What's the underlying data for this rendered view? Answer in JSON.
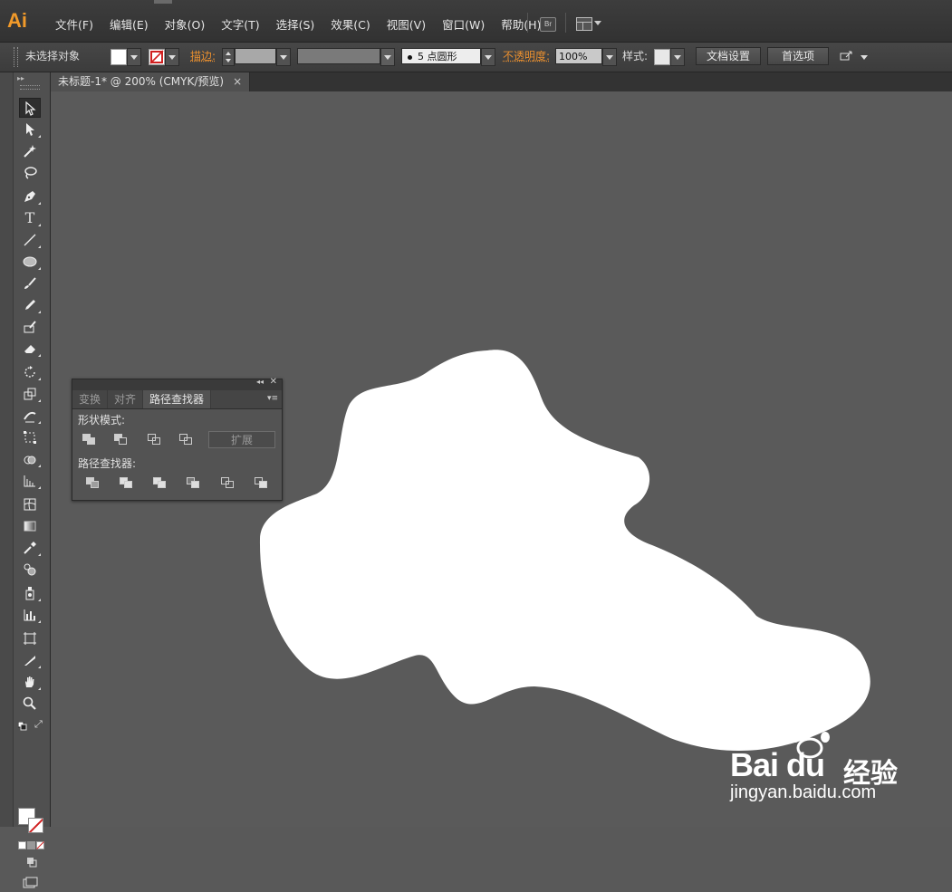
{
  "app": {
    "logo": "Ai",
    "menu": [
      "文件(F)",
      "编辑(E)",
      "对象(O)",
      "文字(T)",
      "选择(S)",
      "效果(C)",
      "视图(V)",
      "窗口(W)",
      "帮助(H)"
    ],
    "bridge_label": "Br"
  },
  "control_bar": {
    "selection_status": "未选择对象",
    "stroke_label": "描边:",
    "brush_value": "5 点圆形",
    "opacity_label": "不透明度:",
    "opacity_value": "100%",
    "style_label": "样式:",
    "doc_setup_button": "文档设置",
    "preferences_button": "首选项"
  },
  "document_tab": {
    "title": "未标题-1* @ 200% (CMYK/预览)",
    "close": "×"
  },
  "pathfinder_panel": {
    "tabs": [
      "变换",
      "对齐",
      "路径查找器"
    ],
    "active_tab": "路径查找器",
    "shape_modes_label": "形状模式:",
    "pathfinders_label": "路径查找器:",
    "expand_button": "扩展"
  },
  "tools": [
    "selection",
    "direct-selection",
    "magic-wand",
    "lasso",
    "pen",
    "type",
    "line",
    "ellipse",
    "paintbrush",
    "pencil",
    "blob-brush",
    "eraser",
    "rotate",
    "scale",
    "warp",
    "free-transform",
    "shape-builder",
    "perspective-grid",
    "mesh",
    "gradient",
    "eyedropper",
    "blend",
    "symbol-sprayer",
    "column-graph",
    "artboard",
    "slice",
    "hand",
    "zoom"
  ],
  "colors": {
    "accent_orange": "#e98f2f",
    "canvas": "#5a5a5a",
    "shape_fill": "#ffffff",
    "none_slash": "#d02020"
  },
  "watermark": {
    "logo_text": "Bai du",
    "brand_cn": "经验",
    "url": "jingyan.baidu.com"
  }
}
